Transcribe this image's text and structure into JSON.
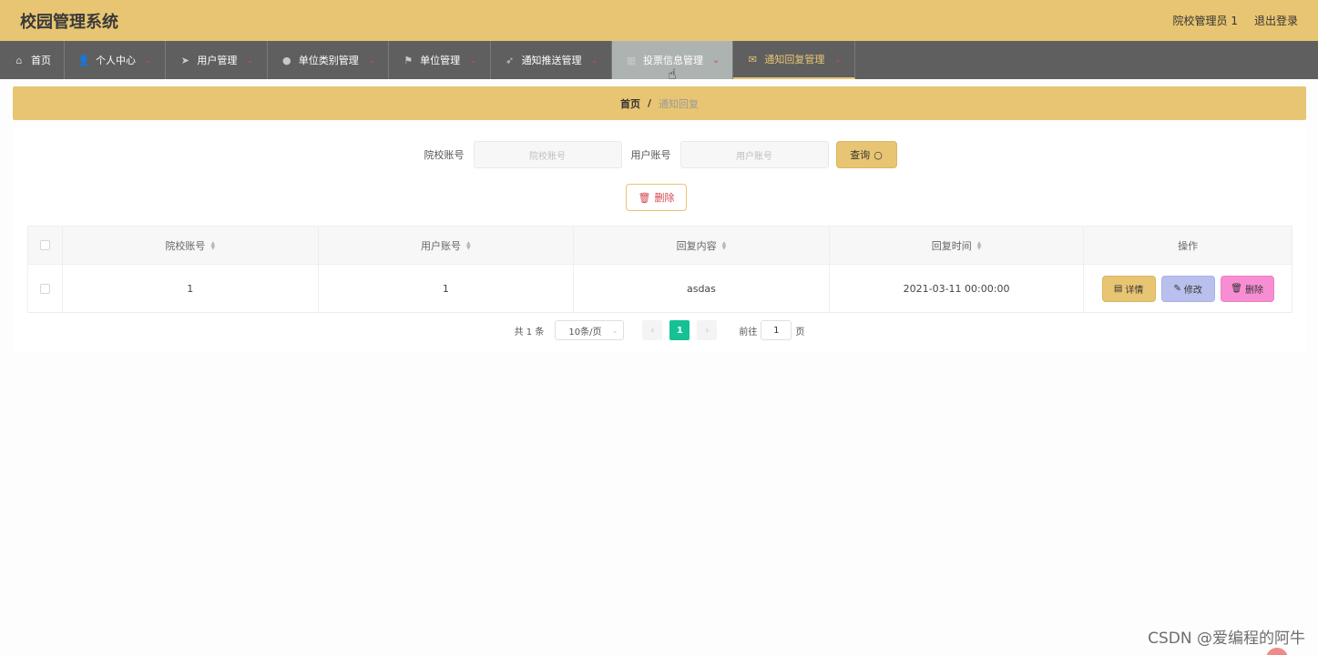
{
  "header": {
    "title": "校园管理系统",
    "user": "院校管理员 1",
    "logout": "退出登录"
  },
  "nav": [
    {
      "label": "首页",
      "icon": "home-icon",
      "glyph": "⌂",
      "chevron": ""
    },
    {
      "label": "个人中心",
      "icon": "user-icon",
      "glyph": "👤",
      "chevron": "⌄"
    },
    {
      "label": "用户管理",
      "icon": "send-icon",
      "glyph": "➤",
      "chevron": "⌄"
    },
    {
      "label": "单位类别管理",
      "icon": "location-pin-icon",
      "glyph": "●",
      "chevron": "⌄"
    },
    {
      "label": "单位管理",
      "icon": "flag-icon",
      "glyph": "⚑",
      "chevron": "⌄"
    },
    {
      "label": "通知推送管理",
      "icon": "navigation-icon",
      "glyph": "➶",
      "chevron": "⌄"
    },
    {
      "label": "投票信息管理",
      "icon": "grid-icon",
      "glyph": "▦",
      "chevron": "⌄"
    },
    {
      "label": "通知回复管理",
      "icon": "mail-icon",
      "glyph": "✉",
      "chevron": "⌄"
    }
  ],
  "breadcrumb": {
    "home": "首页",
    "separator": "/",
    "current": "通知回复"
  },
  "search": {
    "school_label": "院校账号",
    "school_placeholder": "院校账号",
    "user_label": "用户账号",
    "user_placeholder": "用户账号",
    "query_label": "查询"
  },
  "actions": {
    "delete_label": "删除"
  },
  "table": {
    "headers": [
      "院校账号",
      "用户账号",
      "回复内容",
      "回复时间",
      "操作"
    ],
    "rows": [
      {
        "school": "1",
        "user": "1",
        "content": "asdas",
        "time": "2021-03-11 00:00:00"
      }
    ],
    "ops": {
      "detail": "详情",
      "edit": "修改",
      "delete": "删除"
    }
  },
  "pagination": {
    "total": "共 1 条",
    "page_size": "10条/页",
    "current_page": "1",
    "goto_prefix": "前往",
    "goto_value": "1",
    "goto_suffix": "页"
  },
  "watermark": "CSDN @爱编程的阿牛",
  "colors": {
    "accent": "#e8c572",
    "nav_bg": "#5f5f5f",
    "page_active": "#16c193",
    "edit_btn": "#b9c0ee",
    "delete_btn": "#f78ed4"
  }
}
